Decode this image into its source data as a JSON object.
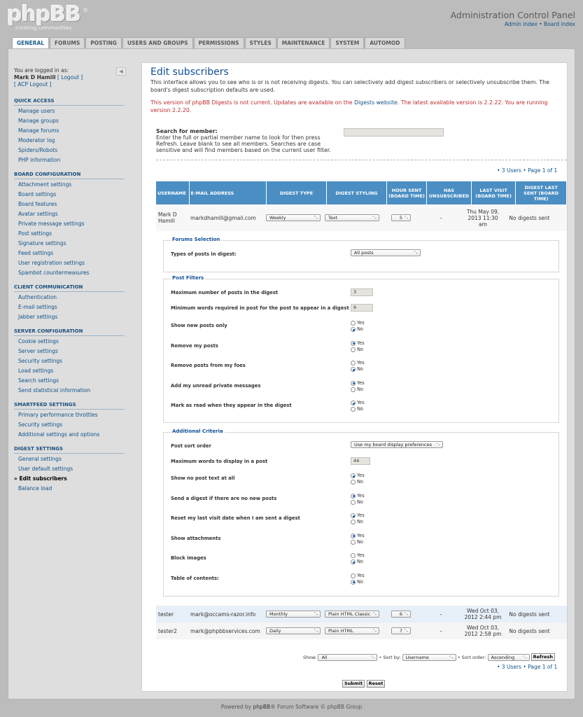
{
  "header": {
    "logo_main": "phpBB",
    "logo_reg": "®",
    "logo_sub": "creating communities",
    "title": "Administration Control Panel",
    "link_admin": "Admin index",
    "sep": " • ",
    "link_board": "Board index"
  },
  "tabs": [
    "GENERAL",
    "FORUMS",
    "POSTING",
    "USERS AND GROUPS",
    "PERMISSIONS",
    "STYLES",
    "MAINTENANCE",
    "SYSTEM",
    "AUTOMOD"
  ],
  "login": {
    "line1": "You are logged in as:",
    "user": "Mark D Hamill",
    "logout": "[ Logout ]",
    "acp_logout": "[ ACP Logout ]"
  },
  "menu": [
    {
      "head": "QUICK ACCESS",
      "items": [
        "Manage users",
        "Manage groups",
        "Manage forums",
        "Moderator log",
        "Spiders/Robots",
        "PHP information"
      ]
    },
    {
      "head": "BOARD CONFIGURATION",
      "items": [
        "Attachment settings",
        "Board settings",
        "Board features",
        "Avatar settings",
        "Private message settings",
        "Post settings",
        "Signature settings",
        "Feed settings",
        "User registration settings",
        "Spambot countermeasures"
      ]
    },
    {
      "head": "CLIENT COMMUNICATION",
      "items": [
        "Authentication",
        "E-mail settings",
        "Jabber settings"
      ]
    },
    {
      "head": "SERVER CONFIGURATION",
      "items": [
        "Cookie settings",
        "Server settings",
        "Security settings",
        "Load settings",
        "Search settings",
        "Send statistical information"
      ]
    },
    {
      "head": "SMARTFEED SETTINGS",
      "items": [
        "Primary performance throttles",
        "Security settings",
        "Additional settings and options"
      ]
    },
    {
      "head": "DIGEST SETTINGS",
      "items": [
        "General settings",
        "User default settings",
        "Edit subscribers",
        "Balance load"
      ]
    }
  ],
  "main": {
    "title": "Edit subscribers",
    "desc": "This interface allows you to see who is or is not receiving digests. You can selectively add digest subscribers or selectively unsubscribe them. The board's digest subscription defaults are used.",
    "version_pre": "This version of phpBB Digests is not current. Updates are available on the ",
    "version_link": "Digests website",
    "version_mid": ". The latest available version is ",
    "version_latest": "2.2.22",
    "version_mid2": ". You are running version ",
    "version_current": "2.2.20",
    "version_end": ".",
    "search_label": "Search for member:",
    "search_help": "Enter the full or partial member name to look for then press Refresh. Leave blank to see all members. Searches are case sensitive and will find members based on the current user filter.",
    "pagination": "• 3 Users • Page 1 of 1"
  },
  "table": {
    "headers": [
      "USERNAME",
      "E-MAIL ADDRESS",
      "DIGEST TYPE",
      "DIGEST STYLING",
      "HOUR SENT (BOARD TIME)",
      "HAS UNSUBSCRIBED",
      "LAST VISIT (BOARD TIME)",
      "DIGEST LAST SENT (BOARD TIME)"
    ],
    "rows": [
      {
        "user": "Mark D Hamill",
        "email": "markdhamill@gmail.com",
        "type": "Weekly",
        "style": "Text",
        "hour": "5",
        "unsub": "–",
        "visit": "Thu May 09, 2013 11:30 am",
        "last": "No digests sent"
      },
      {
        "user": "tester",
        "email": "mark@occams-razor.info",
        "type": "Monthly",
        "style": "Plain HTML Classic",
        "hour": "6",
        "unsub": "–",
        "visit": "Wed Oct 03, 2012 2:44 pm",
        "last": "No digests sent"
      },
      {
        "user": "tester2",
        "email": "mark@phpbbservices.com",
        "type": "Daily",
        "style": "Plain HTML",
        "hour": "7",
        "unsub": "–",
        "visit": "Wed Oct 03, 2012 2:58 pm",
        "last": "No digests sent"
      }
    ]
  },
  "forums_sel": {
    "legend": "Forums Selection",
    "label": "Types of posts in digest:",
    "value": "All posts"
  },
  "post_filters": {
    "legend": "Post Filters",
    "max_posts_label": "Maximum number of posts in the digest",
    "max_posts": "3",
    "min_words_label": "Minimum words required in post for the post to appear in a digest",
    "min_words": "6",
    "radios": [
      {
        "label": "Show new posts only",
        "yes": false
      },
      {
        "label": "Remove my posts",
        "yes": true
      },
      {
        "label": "Remove posts from my foes",
        "yes": false
      },
      {
        "label": "Add my unread private messages",
        "yes": true
      },
      {
        "label": "Mark as read when they appear in the digest",
        "yes": true
      }
    ]
  },
  "additional": {
    "legend": "Additional Criteria",
    "sort_label": "Post sort order",
    "sort_value": "Use my board display preferences",
    "max_words_label": "Maximum words to display in a post",
    "max_words": "44",
    "radios": [
      {
        "label": "Show no post text at all",
        "yes": true
      },
      {
        "label": "Send a digest if there are no new posts",
        "yes": true
      },
      {
        "label": "Reset my last visit date when I am sent a digest",
        "yes": true
      },
      {
        "label": "Show attachments",
        "yes": true
      },
      {
        "label": "Block images",
        "yes": false
      },
      {
        "label": "Table of contents:",
        "yes": false
      }
    ]
  },
  "yes": "Yes",
  "no": "No",
  "controls": {
    "show_label": "Show:",
    "show_value": "All",
    "sort_label": "Sort by:",
    "sort_value": "Username",
    "order_label": "Sort order:",
    "order_value": "Ascending",
    "refresh": "Refresh",
    "submit": "Submit",
    "reset": "Reset"
  },
  "footer": {
    "pre": "Powered by ",
    "link": "phpBB",
    "post": "® Forum Software © phpBB Group"
  }
}
